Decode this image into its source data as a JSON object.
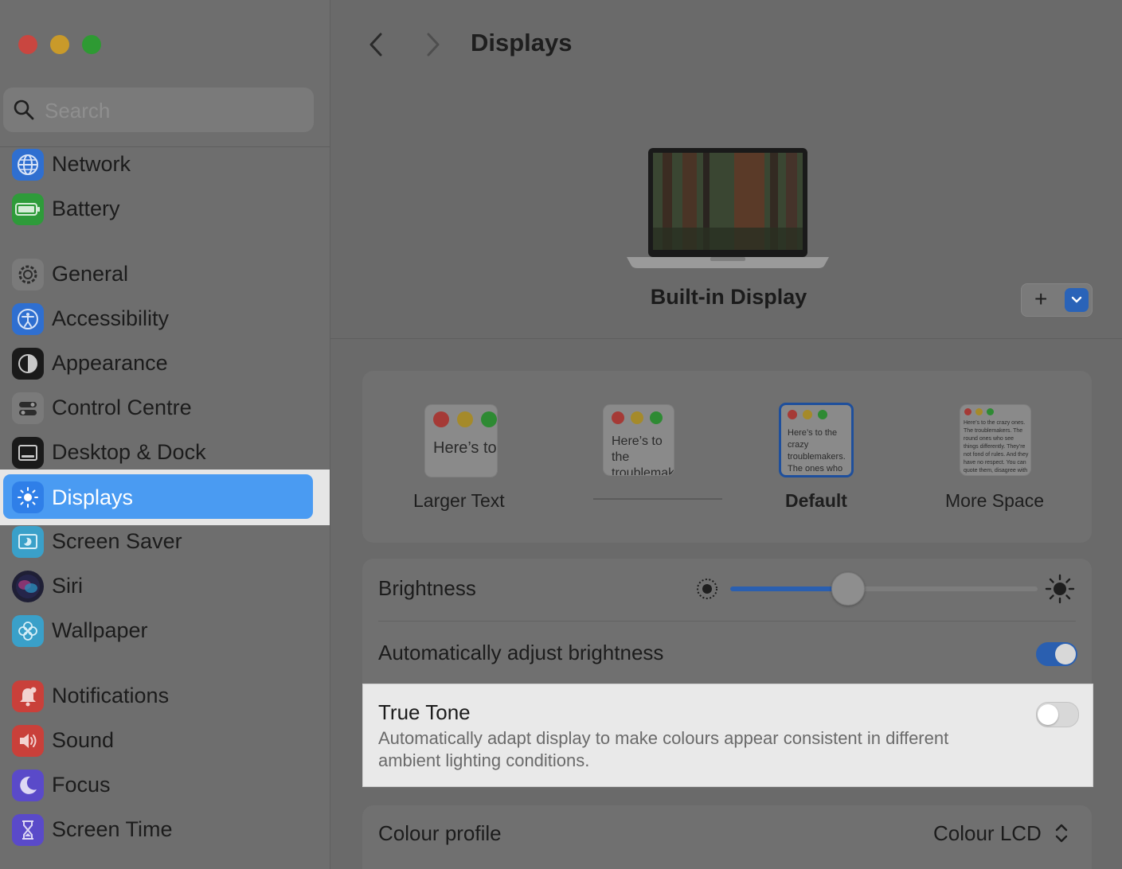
{
  "window": {
    "traffic_lights": [
      "#c94640",
      "#c99a2a",
      "#2e9a33"
    ]
  },
  "search": {
    "placeholder": "Search"
  },
  "sidebar": {
    "items": [
      {
        "label": "Network",
        "icon": "globe-icon",
        "color": "#2f6fd0"
      },
      {
        "label": "Battery",
        "icon": "battery-icon",
        "color": "#2e9b3a"
      },
      {
        "label": "General",
        "icon": "gear-icon",
        "color": "#7a7a7a"
      },
      {
        "label": "Accessibility",
        "icon": "accessibility-icon",
        "color": "#2f6fd0"
      },
      {
        "label": "Appearance",
        "icon": "appearance-icon",
        "color": "#1a1a1a"
      },
      {
        "label": "Control Centre",
        "icon": "control-centre-icon",
        "color": "#7a7a7a"
      },
      {
        "label": "Desktop & Dock",
        "icon": "desktop-dock-icon",
        "color": "#1a1a1a"
      },
      {
        "label": "Displays",
        "icon": "sun-icon",
        "color": "#2f7fe8",
        "selected": true
      },
      {
        "label": "Screen Saver",
        "icon": "screen-saver-icon",
        "color": "#3aa0c9"
      },
      {
        "label": "Siri",
        "icon": "siri-icon",
        "color": "#3a3a6a"
      },
      {
        "label": "Wallpaper",
        "icon": "wallpaper-icon",
        "color": "#3aa0c9"
      },
      {
        "label": "Notifications",
        "icon": "bell-icon",
        "color": "#c9403a"
      },
      {
        "label": "Sound",
        "icon": "speaker-icon",
        "color": "#c9403a"
      },
      {
        "label": "Focus",
        "icon": "moon-icon",
        "color": "#5a4ac9"
      },
      {
        "label": "Screen Time",
        "icon": "hourglass-icon",
        "color": "#5a4ac9"
      }
    ]
  },
  "header": {
    "title": "Displays"
  },
  "display": {
    "name": "Built-in Display",
    "add_label": "+"
  },
  "resolution": {
    "options": [
      {
        "label": "Larger Text",
        "preview": "Here’s to the crazy ones. The troublemakers."
      },
      {
        "label": "",
        "preview": "Here’s to the troublemakers ones who see"
      },
      {
        "label": "Default",
        "preview": "Here’s to the crazy troublemakers. The ones who see things rules. And they"
      },
      {
        "label": "More Space",
        "preview": "Here’s to the crazy ones. The troublemakers. The round ones who see things differently. They’re not fond of rules. And they have no respect. You can quote them, disagree with them. About the only thing you can’t do is ignore them. Because they change things."
      }
    ],
    "selected": "Default"
  },
  "settings": {
    "brightness_label": "Brightness",
    "brightness_value": 0.38,
    "auto_brightness_label": "Automatically adjust brightness",
    "auto_brightness_on": true,
    "true_tone_label": "True Tone",
    "true_tone_desc": "Automatically adapt display to make colours appear consistent in different ambient lighting conditions.",
    "true_tone_on": false,
    "colour_profile_label": "Colour profile",
    "colour_profile_value": "Colour LCD"
  },
  "colors": {
    "accent": "#4a9bf2",
    "toggle_on": "#2a5fb0"
  }
}
